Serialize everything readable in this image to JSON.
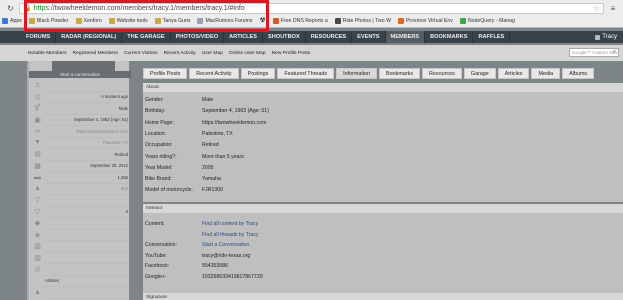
{
  "browser": {
    "url_https": "https",
    "url_rest": "://twowheeldemon.com/members/tracy.1/members/tracy.1/#info",
    "bookmarks": [
      {
        "label": "Apps",
        "icon": "apps-icon",
        "color": "#3b79d8"
      },
      {
        "label": "Black Powder",
        "icon": "folder-icon",
        "color": "#c9a84b"
      },
      {
        "label": "Xenforo",
        "icon": "folder-icon",
        "color": "#c9a84b"
      },
      {
        "label": "Website tools",
        "icon": "folder-icon",
        "color": "#c9a84b"
      },
      {
        "label": "Tanya Guns",
        "icon": "folder-icon",
        "color": "#c9a84b"
      },
      {
        "label": "MacRumors Forums",
        "icon": "site-icon",
        "color": "#9aa3ad"
      },
      {
        "label": "",
        "icon": "radiation-icon",
        "color": "#222222"
      },
      {
        "label": "Free DNS Reports a",
        "icon": "site-icon",
        "color": "#d45a2a"
      },
      {
        "label": "Ride Photos | Two W",
        "icon": "site-icon",
        "color": "#4a4a4a"
      },
      {
        "label": "Proxmox Virtual Env",
        "icon": "site-icon",
        "color": "#e06a1b"
      },
      {
        "label": "NodeQuery - Manag",
        "icon": "site-icon",
        "color": "#44a44a"
      }
    ]
  },
  "nav": {
    "items": [
      "FORUMS",
      "RADAR (REGIONAL)",
      "THE GARAGE",
      "PHOTOS/VIDEO",
      "ARTICLES",
      "SHOUTBOX",
      "RESOURCES",
      "EVENTS",
      "MEMBERS",
      "BOOKMARKS",
      "RAFFLES"
    ],
    "active_index": 8,
    "user": "Tracy"
  },
  "subnav": {
    "items": [
      "Notable Members",
      "Registered Members",
      "Current Visitors",
      "Recent Activity",
      "User Map",
      "Online User Map",
      "New Profile Posts"
    ],
    "search_placeholder": "Google™ Custom Sea"
  },
  "sidebar": {
    "start_conversation": "Start a conversation",
    "rows": [
      {
        "icon": "warning-icon",
        "value": "",
        "faint": false
      },
      {
        "icon": "clock-icon",
        "value": "A moment ago",
        "faint": false
      },
      {
        "icon": "gender-icon",
        "value": "Male",
        "faint": false
      },
      {
        "icon": "gift-icon",
        "value": "September 4, 1963 (Age: 51)",
        "faint": false
      },
      {
        "icon": "link-icon",
        "value": "https://twowheeldemon.com",
        "faint": true
      },
      {
        "icon": "location-icon",
        "value": "Palestine, TX",
        "faint": true
      },
      {
        "icon": "briefcase-icon",
        "value": "Retired",
        "faint": false
      },
      {
        "icon": "calendar-icon",
        "value": "September 30, 2012",
        "faint": false
      },
      {
        "icon": "comments-icon",
        "value": "1,365",
        "faint": false
      },
      {
        "icon": "thumbs-up-icon",
        "value": "602",
        "faint": true
      },
      {
        "icon": "trophy-icon",
        "value": "",
        "faint": false
      },
      {
        "icon": "trophy-icon",
        "value": "0",
        "faint": false
      },
      {
        "icon": "diamond-icon",
        "value": "",
        "faint": false
      },
      {
        "icon": "shield-icon",
        "value": "",
        "faint": false
      },
      {
        "icon": "chart-icon",
        "value": "",
        "faint": false
      },
      {
        "icon": "chart-icon",
        "value": "",
        "faint": false
      },
      {
        "icon": "motorcycle-icon",
        "value": "",
        "faint": false
      },
      {
        "icon": "",
        "value": "Articles:",
        "faint": false
      },
      {
        "icon": "thumbs-up-icon",
        "value": "",
        "faint": false
      }
    ]
  },
  "tabs": [
    "Profile Posts",
    "Recent Activity",
    "Postings",
    "Featured Threads",
    "Information",
    "Bookmarks",
    "Resources",
    "Garage",
    "Articles",
    "Media",
    "Albums"
  ],
  "about": {
    "title": "About",
    "rows": [
      {
        "k": "Gender:",
        "v": "Male",
        "link": false
      },
      {
        "k": "Birthday:",
        "v": "September 4, 1963 (Age: 51)",
        "link": false
      },
      {
        "k": "Home Page:",
        "v": "https://twowheeldemon.com",
        "link": false
      },
      {
        "k": "Location:",
        "v": "Palestine, TX",
        "link": false
      },
      {
        "k": "Occupation:",
        "v": "Retired",
        "link": false
      },
      {
        "k": "Years riding?:",
        "v": "More than 5 years",
        "link": false
      },
      {
        "k": "Year Model:",
        "v": "2005",
        "link": false
      },
      {
        "k": "Bike Brand:",
        "v": "Yamaha",
        "link": false
      },
      {
        "k": "Model of motorcycle:",
        "v": "FJR1300",
        "link": false
      }
    ]
  },
  "interact": {
    "title": "Interact",
    "rows": [
      {
        "k": "Content:",
        "v": "Find all content by Tracy",
        "link": true
      },
      {
        "k": "",
        "v": "Find all threads by Tracy",
        "link": true
      },
      {
        "k": "Conversation:",
        "v": "Start a Conversation",
        "link": true
      },
      {
        "k": "YouTube:",
        "v": "tracy@ride-texas.org",
        "link": false
      },
      {
        "k": "Facebook:",
        "v": "554353986",
        "link": false
      },
      {
        "k": "Google+:",
        "v": "103258633419817867720",
        "link": false
      }
    ]
  },
  "signature": {
    "title": "Signature"
  }
}
